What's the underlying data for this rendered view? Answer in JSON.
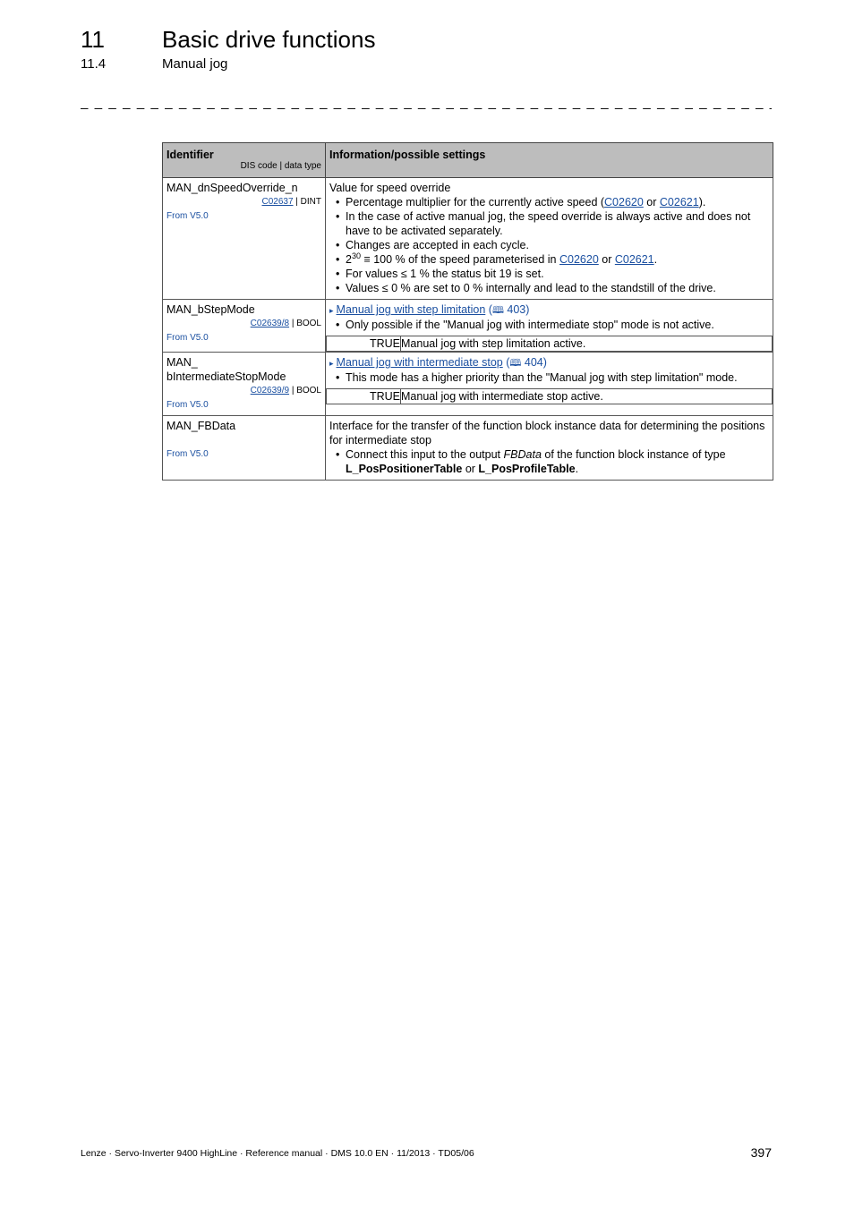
{
  "header": {
    "chapter_number": "11",
    "chapter_title": "Basic drive functions",
    "section_number": "11.4",
    "section_title": "Manual jog",
    "separator": "_ _ _ _ _ _ _ _ _ _ _ _ _ _ _ _ _ _ _ _ _ _ _ _ _ _ _ _ _ _ _ _ _ _ _ _ _ _ _ _ _ _ _ _ _ _ _ _ _ _ _ _ _ _ _ _ _ _ _ _ _ _ _ _"
  },
  "table": {
    "col1_header": "Identifier",
    "col1_subheader": "DIS code | data type",
    "col2_header": "Information/possible settings",
    "rows": [
      {
        "identifier": "MAN_dnSpeedOverride_n",
        "dis_code": "C02637",
        "data_type": " | DINT",
        "from": "From V5.0",
        "intro": "Value for speed override",
        "bullets": {
          "b0_pre": "Percentage multiplier for the currently active speed (",
          "b0_link1": "C02620",
          "b0_mid": " or ",
          "b0_link2": "C02621",
          "b0_post": ").",
          "b1": "In the case of active manual jog, the speed override is always active and does not have to be activated separately.",
          "b2": "Changes are accepted in each cycle.",
          "b3_base": "2",
          "b3_exp": "30",
          "b3_pre": " ≡ 100 % of the speed parameterised in ",
          "b3_link1": "C02620",
          "b3_mid": " or ",
          "b3_link2": "C02621",
          "b3_post": ".",
          "b4": "For values ≤ 1 % the status bit 19 is set.",
          "b5": "Values ≤ 0 % are set to 0 % internally and lead to the standstill of the drive."
        }
      },
      {
        "identifier": "MAN_bStepMode",
        "dis_code": "C02639/8",
        "data_type": " | BOOL",
        "from": "From V5.0",
        "link": "Manual jog with step limitation",
        "page_ref": "403",
        "bullet": "Only possible if the \"Manual jog with intermediate stop\" mode is not active.",
        "value": "TRUE",
        "value_desc": "Manual jog with step limitation active."
      },
      {
        "identifier_line1": "MAN_",
        "identifier_line2": "bIntermediateStopMode",
        "dis_code": "C02639/9",
        "data_type": " | BOOL",
        "from": "From V5.0",
        "link": "Manual jog with intermediate stop",
        "page_ref": "404",
        "bullet": "This mode has a higher priority than the \"Manual jog with step limitation\" mode.",
        "value": "TRUE",
        "value_desc": "Manual jog with intermediate stop active."
      },
      {
        "identifier": "MAN_FBData",
        "from": "From V5.0",
        "intro": "Interface for the transfer of the function block instance data for determining the positions for intermediate stop",
        "b0_pre": "Connect this input to the output ",
        "b0_italic": "FBData",
        "b0_mid": " of the function block instance of type ",
        "b0_bold1": "L_PosPositionerTable",
        "b0_or": " or ",
        "b0_bold2": "L_PosProfileTable",
        "b0_post": "."
      }
    ]
  },
  "footer": {
    "text": "Lenze · Servo-Inverter 9400 HighLine · Reference manual · DMS 10.0 EN · 11/2013 · TD05/06",
    "page_number": "397"
  },
  "icons": {
    "arrow": "▸",
    "book": "🕮"
  }
}
